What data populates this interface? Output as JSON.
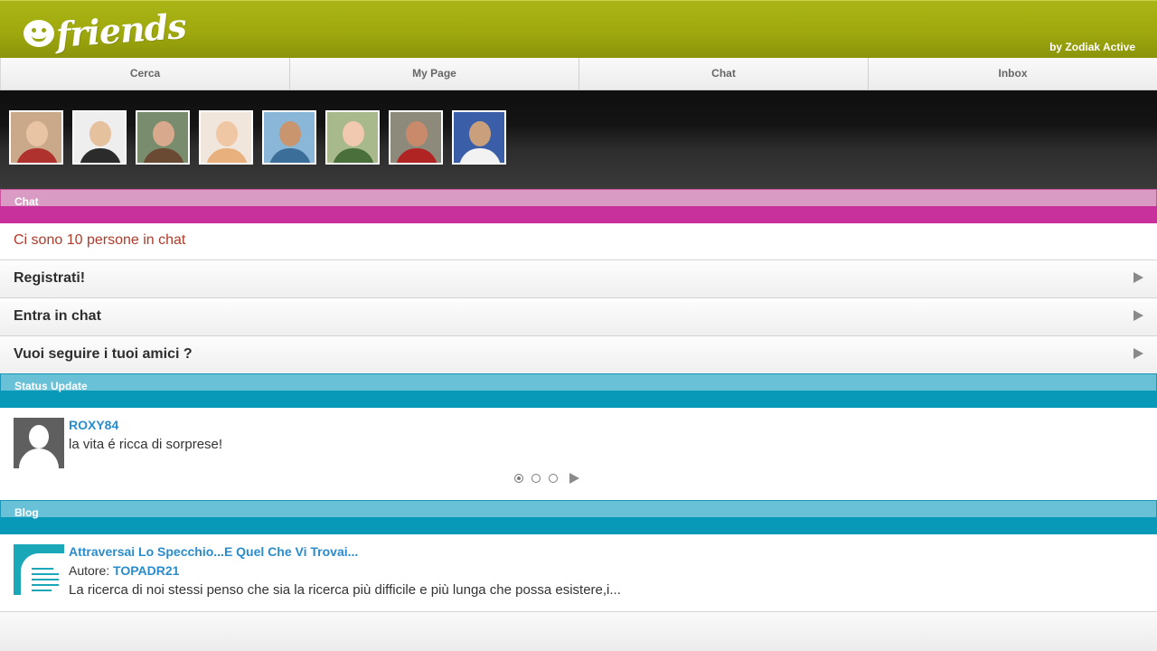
{
  "header": {
    "logo_text": "friends",
    "byline": "by Zodiak Active",
    "colors": {
      "bar": "#9fa90e",
      "logo": "#ffffff"
    }
  },
  "tabs": [
    {
      "label": "Cerca"
    },
    {
      "label": "My Page"
    },
    {
      "label": "Chat"
    },
    {
      "label": "Inbox"
    }
  ],
  "avatar_strip": {
    "avatars": [
      {
        "bg": "#c9a98a",
        "head": "#e9c4a4",
        "body": "#b0322f"
      },
      {
        "bg": "#eeeeee",
        "head": "#e6c19e",
        "body": "#2b2b2b"
      },
      {
        "bg": "#7a8c6e",
        "head": "#d8a98c",
        "body": "#6b4a33"
      },
      {
        "bg": "#f1e6dc",
        "head": "#f0c7a4",
        "body": "#e7b07c"
      },
      {
        "bg": "#8ab6d8",
        "head": "#c9956f",
        "body": "#3b6f9a"
      },
      {
        "bg": "#a8b98c",
        "head": "#f1c9b0",
        "body": "#4a6f3a"
      },
      {
        "bg": "#8d8a7c",
        "head": "#c98a6c",
        "body": "#b02424"
      },
      {
        "bg": "#3a5fa8",
        "head": "#caa07c",
        "body": "#f2f2f2"
      }
    ]
  },
  "chat_section": {
    "title": "Chat",
    "count_text": "Ci sono 10 persone in chat",
    "items": [
      {
        "label": "Registrati!"
      },
      {
        "label": "Entra in chat"
      },
      {
        "label": "Vuoi seguire i tuoi amici ?"
      }
    ],
    "colors": {
      "header": "#c8319b",
      "count_text": "#b03a2a"
    }
  },
  "status_section": {
    "title": "Status Update",
    "user": "ROXY84",
    "text": "la vita é ricca di sorprese!",
    "pager": {
      "pages": 3,
      "current": 1
    },
    "colors": {
      "header": "#0898b8",
      "link": "#2a8ccc"
    }
  },
  "blog_section": {
    "title": "Blog",
    "post_title": "Attraversai Lo Specchio...E Quel Che Vi Trovai...",
    "author_label": "Autore:",
    "author": "TOPADR21",
    "excerpt": "La ricerca di noi stessi penso che sia la ricerca più difficile e più lunga che possa esistere,i..."
  }
}
